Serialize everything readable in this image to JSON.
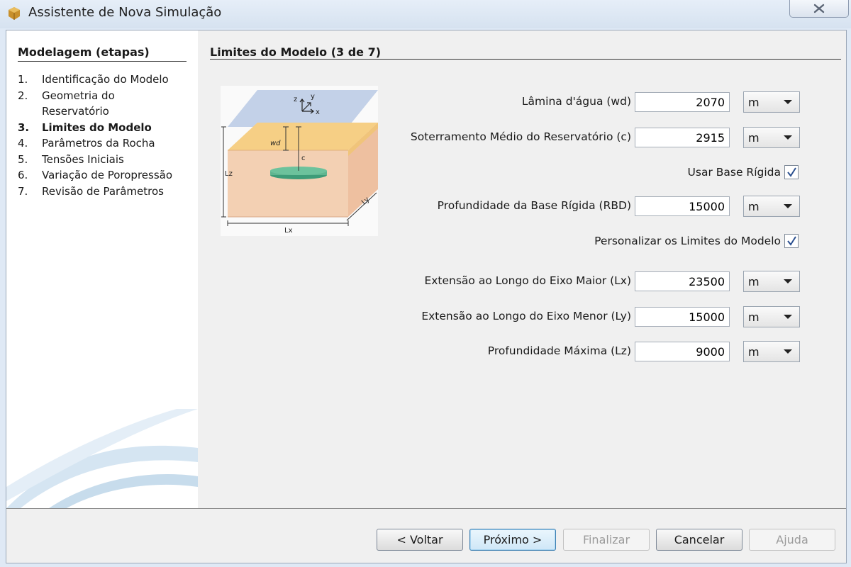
{
  "window": {
    "title": "Assistente de Nova Simulação"
  },
  "sidebar": {
    "heading": "Modelagem (etapas)",
    "steps": [
      {
        "num": "1.",
        "label": "Identificação do Modelo"
      },
      {
        "num": "2.",
        "label": "Geometria do Reservatório"
      },
      {
        "num": "3.",
        "label": "Limites do Modelo"
      },
      {
        "num": "4.",
        "label": "Parâmetros da Rocha"
      },
      {
        "num": "5.",
        "label": "Tensões Iniciais"
      },
      {
        "num": "6.",
        "label": "Variação de Poropressão"
      },
      {
        "num": "7.",
        "label": "Revisão de Parâmetros"
      }
    ],
    "active_step": 3
  },
  "main": {
    "heading": "Limites do Modelo (3 de 7)",
    "diagram": {
      "z": "z",
      "y": "y",
      "x": "x",
      "wd": "wd",
      "c": "c",
      "lz": "Lz",
      "lx": "Lx",
      "ly": "Ly"
    },
    "fields": {
      "wd": {
        "label": "Lâmina d'água (wd)",
        "value": "2070",
        "unit": "m"
      },
      "c": {
        "label": "Soterramento Médio do Reservatório (c)",
        "value": "2915",
        "unit": "m"
      },
      "use_rigid": {
        "label": "Usar Base Rígida",
        "checked": true
      },
      "rbd": {
        "label": "Profundidade da Base Rígida (RBD)",
        "value": "15000",
        "unit": "m"
      },
      "customize": {
        "label": "Personalizar os Limites do Modelo",
        "checked": true
      },
      "lx": {
        "label": "Extensão ao Longo do Eixo Maior (Lx)",
        "value": "23500",
        "unit": "m"
      },
      "ly": {
        "label": "Extensão ao Longo do Eixo Menor (Ly)",
        "value": "15000",
        "unit": "m"
      },
      "lz": {
        "label": "Profundidade Máxima (Lz)",
        "value": "9000",
        "unit": "m"
      }
    }
  },
  "buttons": {
    "back": "< Voltar",
    "next": "Próximo >",
    "finish": "Finalizar",
    "cancel": "Cancelar",
    "help": "Ajuda"
  },
  "icons": {
    "app": "app-icon",
    "close": "close-icon",
    "check": "checkmark-icon",
    "dropdown": "chevron-down-icon"
  },
  "colors": {
    "water_layer": "#b9c9e4",
    "overburden": "#f6cf85",
    "reservoir": "#4ea985",
    "rock": "#f3d0b3",
    "accent": "#3c7fb1"
  }
}
